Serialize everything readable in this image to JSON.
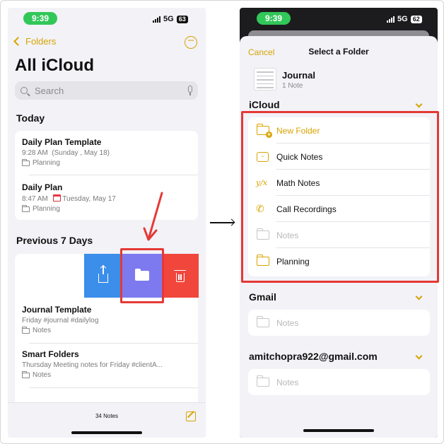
{
  "left": {
    "status": {
      "time": "9:39",
      "network": "5G",
      "battery": "63"
    },
    "nav": {
      "back_label": "Folders",
      "more_glyph": "···"
    },
    "title": "All iCloud",
    "search": {
      "placeholder": "Search"
    },
    "sections": {
      "today": "Today",
      "previous": "Previous 7 Days"
    },
    "today_notes": [
      {
        "title": "Daily Plan Template",
        "time": "9:28 AM",
        "meta": "(Sunday , May 18)",
        "folder": "Planning"
      },
      {
        "title": "Daily Plan",
        "time": "8:47 AM",
        "meta": "Tuesday, May 17",
        "folder": "Planning"
      }
    ],
    "previous_notes": [
      {
        "title": "Journal Template",
        "meta": "Friday  #journal #dailylog",
        "folder": "Notes"
      },
      {
        "title": "Smart Folders",
        "meta": "Thursday  Meeting notes for Friday #clientA...",
        "folder": "Notes"
      }
    ],
    "swipe_actions": {
      "share": "share-icon",
      "move": "folder-icon",
      "delete": "trash-icon"
    },
    "footer": {
      "count": "34 Notes"
    }
  },
  "right": {
    "status": {
      "time": "9:39",
      "network": "5G",
      "battery": "62"
    },
    "cancel_label": "Cancel",
    "sheet_title": "Select a Folder",
    "note": {
      "title": "Journal",
      "subtitle": "1 Note"
    },
    "accounts": [
      {
        "name": "iCloud",
        "folders": [
          {
            "label": "New Folder",
            "icon": "new-folder-icon",
            "style": "accent"
          },
          {
            "label": "Quick Notes",
            "icon": "quick-notes-icon",
            "style": "normal"
          },
          {
            "label": "Math Notes",
            "icon": "math-notes-icon",
            "style": "normal"
          },
          {
            "label": "Call Recordings",
            "icon": "call-recordings-icon",
            "style": "normal"
          },
          {
            "label": "Notes",
            "icon": "folder-icon",
            "style": "dim"
          },
          {
            "label": "Planning",
            "icon": "folder-icon",
            "style": "normal"
          }
        ]
      },
      {
        "name": "Gmail",
        "folders": [
          {
            "label": "Notes",
            "icon": "folder-icon",
            "style": "dim"
          }
        ]
      },
      {
        "name": "amitchopra922@gmail.com",
        "folders": [
          {
            "label": "Notes",
            "icon": "folder-icon",
            "style": "dim"
          }
        ]
      }
    ]
  },
  "colors": {
    "accent": "#d9a400",
    "status_pill": "#32c759",
    "share_button": "#3b8eea",
    "move_button": "#7d7af0",
    "delete_button": "#f0463c",
    "highlight_box": "#e53935"
  }
}
